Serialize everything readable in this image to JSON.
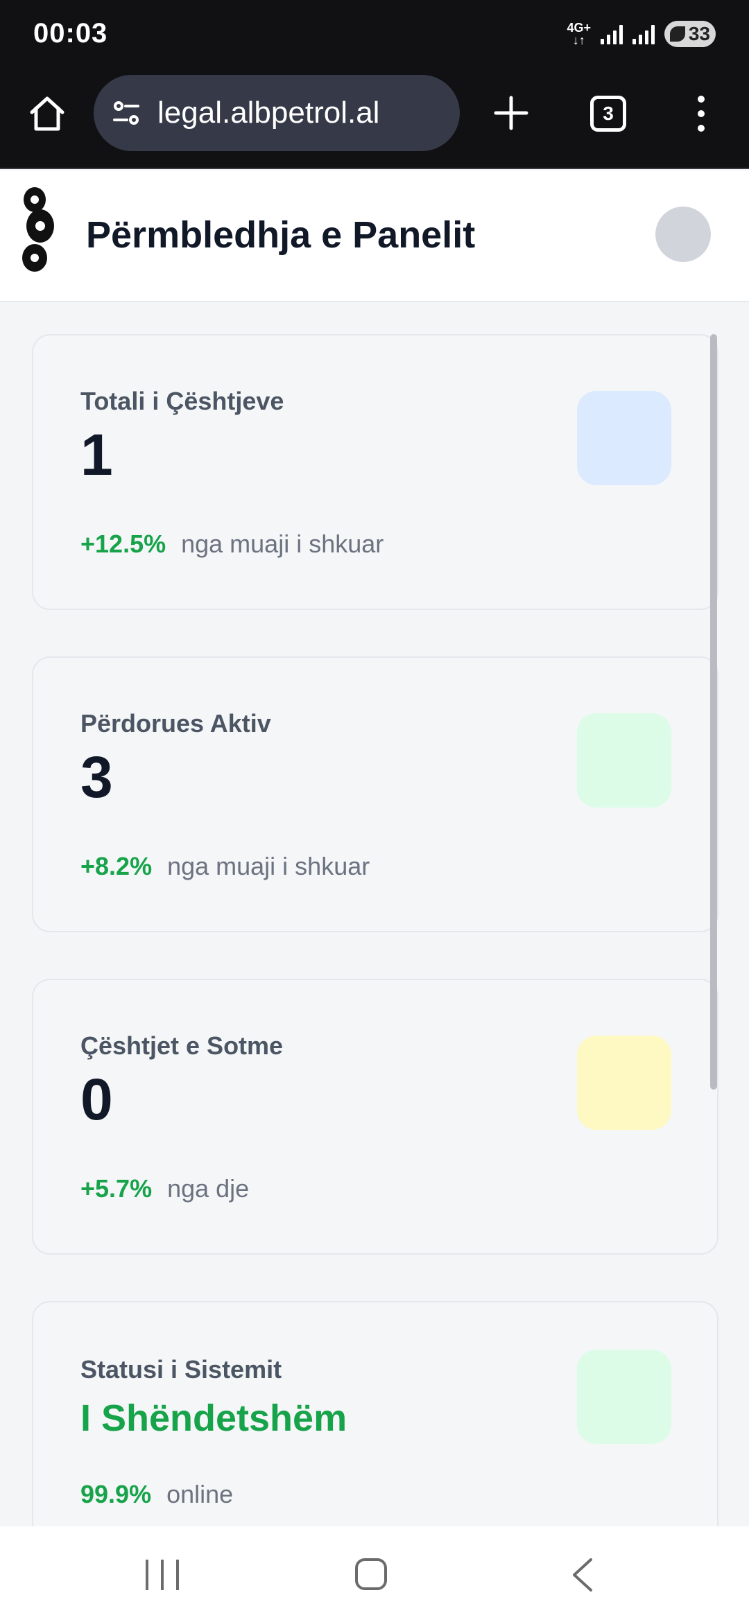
{
  "status_bar": {
    "time": "00:03",
    "network": "4G+",
    "battery": "33"
  },
  "browser": {
    "url": "legal.albpetrol.al",
    "tab_count": "3"
  },
  "header": {
    "title": "Përmbledhja e Panelit"
  },
  "cards": [
    {
      "label": "Totali i Çështjeve",
      "value": "1",
      "change": "+12.5%",
      "period": "nga muaji i shkuar",
      "icon_color": "#dbeafe"
    },
    {
      "label": "Përdorues Aktiv",
      "value": "3",
      "change": "+8.2%",
      "period": "nga muaji i shkuar",
      "icon_color": "#dcfce7"
    },
    {
      "label": "Çështjet e Sotme",
      "value": "0",
      "change": "+5.7%",
      "period": "nga dje",
      "icon_color": "#fef9c3"
    },
    {
      "label": "Statusi i Sistemit",
      "value": "I Shëndetshëm",
      "change": "99.9%",
      "period": "online",
      "icon_color": "#dcfce7"
    }
  ],
  "colors": {
    "accent_green": "#16a34a",
    "title": "#111827",
    "muted": "#6b7280"
  }
}
